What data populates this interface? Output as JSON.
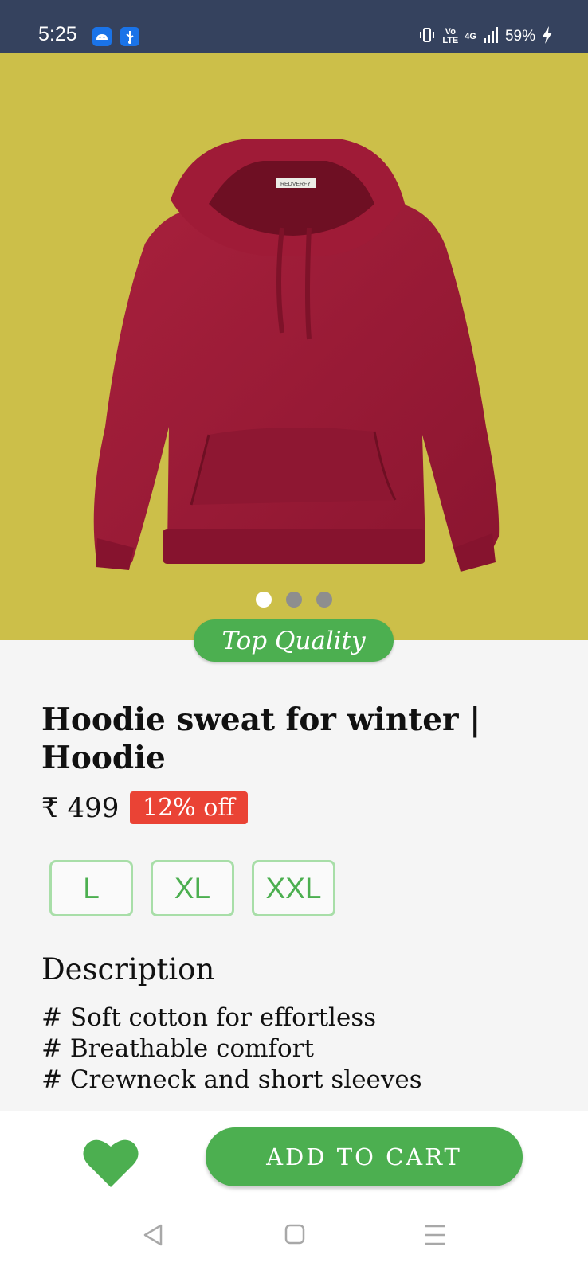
{
  "status_bar": {
    "time": "5:25",
    "indicators": {
      "volte_top": "Vo",
      "volte_bottom": "LTE",
      "network": "4G",
      "battery": "59%"
    },
    "icons": [
      "android-icon",
      "usb-icon",
      "vibrate-icon",
      "signal-icon",
      "charging-icon"
    ]
  },
  "hero": {
    "background_color": "#ccbf49",
    "product_color": "#9b1b34",
    "label_text": "REDVERFY",
    "carousel": {
      "count": 3,
      "active_index": 0
    }
  },
  "product": {
    "badge": "Top Quality",
    "title_line1": "Hoodie sweat for winter |",
    "title_line2": "Hoodie",
    "price": "₹ 499",
    "discount": "12% off",
    "sizes": [
      "L",
      "XL",
      "XXL"
    ]
  },
  "description": {
    "heading": "Description",
    "lines": [
      "# Soft cotton for effortless",
      "# Breathable comfort",
      "# Crewneck and short sleeves"
    ]
  },
  "actions": {
    "wishlist_icon": "heart-icon",
    "add_to_cart": "ADD TO CART"
  },
  "nav": {
    "icons": [
      "back-icon",
      "home-icon",
      "menu-icon"
    ]
  },
  "colors": {
    "accent": "#4caf50",
    "discount": "#ea4335",
    "status_bar": "#35425e"
  }
}
